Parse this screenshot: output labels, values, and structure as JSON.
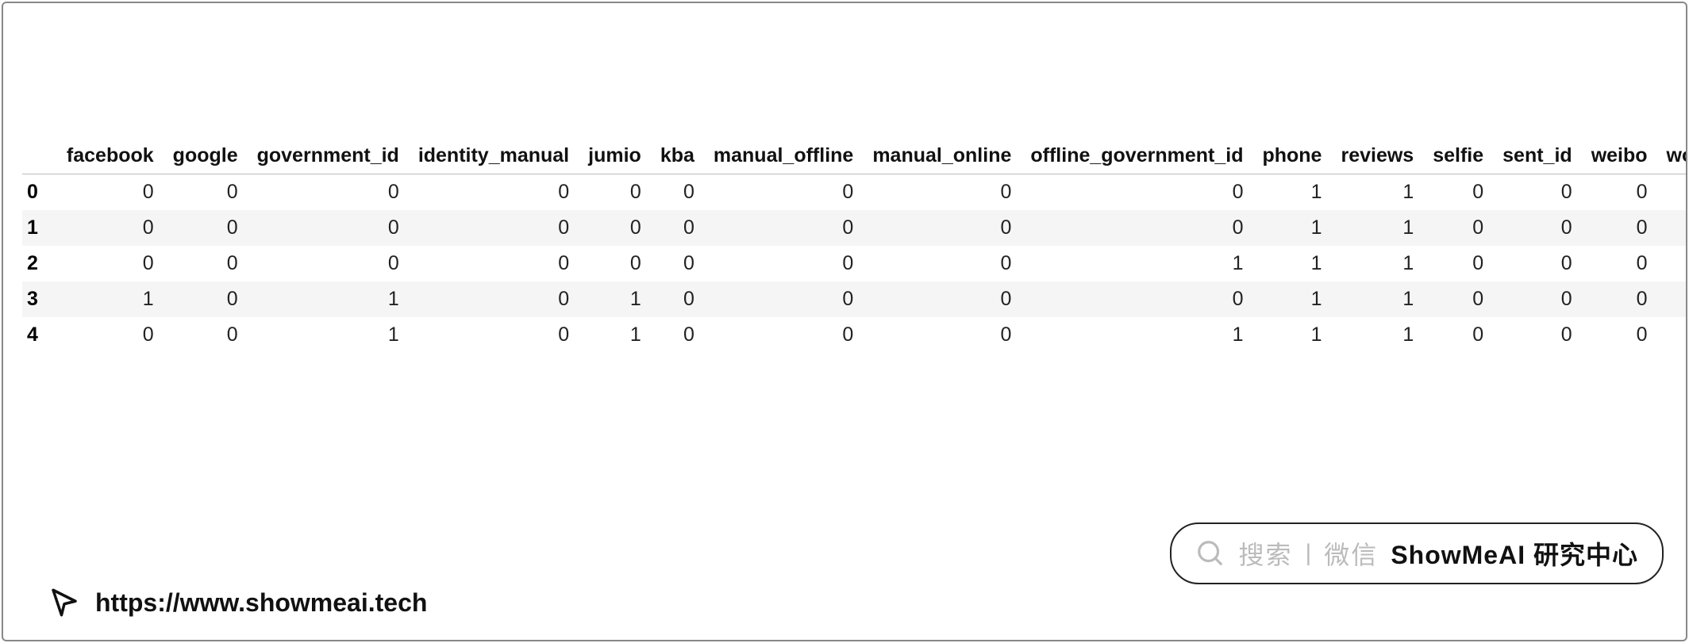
{
  "table": {
    "columns": [
      "facebook",
      "google",
      "government_id",
      "identity_manual",
      "jumio",
      "kba",
      "manual_offline",
      "manual_online",
      "offline_government_id",
      "phone",
      "reviews",
      "selfie",
      "sent_id",
      "weibo",
      "work_em"
    ],
    "index": [
      "0",
      "1",
      "2",
      "3",
      "4"
    ],
    "rows": [
      [
        0,
        0,
        0,
        0,
        0,
        0,
        0,
        0,
        0,
        1,
        1,
        0,
        0,
        0,
        ""
      ],
      [
        0,
        0,
        0,
        0,
        0,
        0,
        0,
        0,
        0,
        1,
        1,
        0,
        0,
        0,
        ""
      ],
      [
        0,
        0,
        0,
        0,
        0,
        0,
        0,
        0,
        1,
        1,
        1,
        0,
        0,
        0,
        ""
      ],
      [
        1,
        0,
        1,
        0,
        1,
        0,
        0,
        0,
        0,
        1,
        1,
        0,
        0,
        0,
        ""
      ],
      [
        0,
        0,
        1,
        0,
        1,
        0,
        0,
        0,
        1,
        1,
        1,
        0,
        0,
        0,
        ""
      ]
    ]
  },
  "footer": {
    "url": "https://www.showmeai.tech"
  },
  "search_badge": {
    "hint": "搜索",
    "sub": "微信",
    "brand": "ShowMeAI 研究中心"
  }
}
